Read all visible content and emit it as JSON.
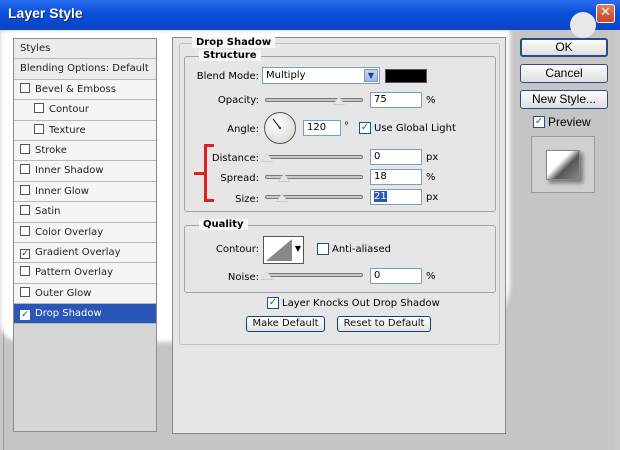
{
  "window": {
    "title": "Layer Style"
  },
  "styles_list": [
    {
      "label": "Styles",
      "checkbox": false,
      "header": true
    },
    {
      "label": "Blending Options: Default",
      "checkbox": false,
      "header": true
    },
    {
      "label": "Bevel & Emboss",
      "checkbox": true,
      "checked": false
    },
    {
      "label": "Contour",
      "checkbox": true,
      "checked": false,
      "indent": true
    },
    {
      "label": "Texture",
      "checkbox": true,
      "checked": false,
      "indent": true
    },
    {
      "label": "Stroke",
      "checkbox": true,
      "checked": false
    },
    {
      "label": "Inner Shadow",
      "checkbox": true,
      "checked": false
    },
    {
      "label": "Inner Glow",
      "checkbox": true,
      "checked": false
    },
    {
      "label": "Satin",
      "checkbox": true,
      "checked": false
    },
    {
      "label": "Color Overlay",
      "checkbox": true,
      "checked": false
    },
    {
      "label": "Gradient Overlay",
      "checkbox": true,
      "checked": true
    },
    {
      "label": "Pattern Overlay",
      "checkbox": true,
      "checked": false
    },
    {
      "label": "Outer Glow",
      "checkbox": true,
      "checked": false
    },
    {
      "label": "Drop Shadow",
      "checkbox": true,
      "checked": true,
      "selected": true
    }
  ],
  "drop_shadow": {
    "title": "Drop Shadow",
    "structure": {
      "title": "Structure",
      "blend_mode_label": "Blend Mode:",
      "blend_mode_value": "Multiply",
      "shadow_color": "#000000",
      "opacity_label": "Opacity:",
      "opacity_value": "75",
      "opacity_unit": "%",
      "angle_label": "Angle:",
      "angle_value": "120",
      "angle_unit": "°",
      "use_global_light_label": "Use Global Light",
      "use_global_light_checked": true,
      "distance_label": "Distance:",
      "distance_value": "0",
      "distance_unit": "px",
      "spread_label": "Spread:",
      "spread_value": "18",
      "spread_unit": "%",
      "size_label": "Size:",
      "size_value": "21",
      "size_unit": "px"
    },
    "quality": {
      "title": "Quality",
      "contour_label": "Contour:",
      "anti_aliased_label": "Anti-aliased",
      "anti_aliased_checked": false,
      "noise_label": "Noise:",
      "noise_value": "0",
      "noise_unit": "%"
    },
    "layer_knocks_out_label": "Layer Knocks Out Drop Shadow",
    "layer_knocks_out_checked": true,
    "make_default_label": "Make Default",
    "reset_default_label": "Reset to Default"
  },
  "buttons": {
    "ok": "OK",
    "cancel": "Cancel",
    "new_style": "New Style...",
    "preview_label": "Preview",
    "preview_checked": true
  },
  "colors": {
    "accent": "#2a56b8",
    "titlebar": "#0a4fd8",
    "annotation": "#e02020"
  }
}
